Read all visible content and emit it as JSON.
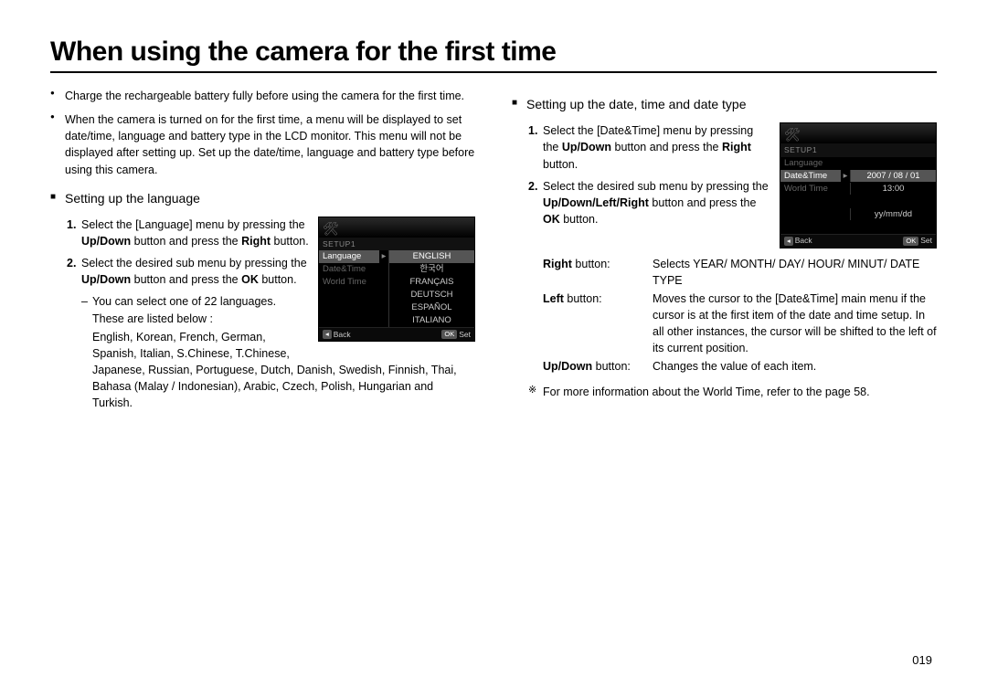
{
  "title": "When using the camera for the first time",
  "intro": {
    "p1": "Charge the rechargeable battery fully before using the camera for the first time.",
    "p2": "When the camera is turned on for the first time, a menu will be displayed to set date/time, language and battery type in the LCD monitor. This menu will not be displayed after setting up. Set up the date/time, language and battery type before using this camera."
  },
  "lang": {
    "heading": "Setting up the language",
    "step1_a": "Select the [Language] menu by pressing the ",
    "step1_b": "Up/Down",
    "step1_c": " button and press the ",
    "step1_d": "Right",
    "step1_e": " button.",
    "step2_a": "Select the desired sub menu by pressing the ",
    "step2_b": "Up/Down",
    "step2_c": " button and press the ",
    "step2_d": "OK",
    "step2_e": " button.",
    "note1": "You can select one of 22 languages. These are listed below :",
    "note2": "English, Korean, French, German, Spanish, Italian, S.Chinese, T.Chinese, Japanese, Russian, Portuguese, Dutch, Danish, Swedish, Finnish, Thai, Bahasa (Malay / Indonesian), Arabic, Czech, Polish, Hungarian and Turkish."
  },
  "lcd_lang": {
    "setup": "SETUP1",
    "rows": [
      {
        "left": "Language",
        "right": "ENGLISH",
        "selLeft": true,
        "selRight": true
      },
      {
        "left": "Date&Time",
        "right": "한국어"
      },
      {
        "left": "World Time",
        "right": "FRANÇAIS"
      },
      {
        "left": "",
        "right": "DEUTSCH"
      },
      {
        "left": "",
        "right": "ESPAÑOL"
      },
      {
        "left": "",
        "right": "ITALIANO"
      }
    ],
    "back": "Back",
    "set": "Set",
    "ok": "OK"
  },
  "date": {
    "heading": "Setting up the date, time and date type",
    "step1_a": "Select the [Date&Time] menu by pressing the ",
    "step1_b": "Up/Down",
    "step1_c": " button and press the ",
    "step1_d": "Right",
    "step1_e": " button.",
    "step2_a": "Select the desired sub menu by pressing the ",
    "step2_b": "Up/Down/Left/Right",
    "step2_c": " button and press the ",
    "step2_d": "OK",
    "step2_e": " button.",
    "right_label": "Right",
    "right_suffix": " button:",
    "right_val": "Selects YEAR/ MONTH/ DAY/ HOUR/ MINUT/ DATE TYPE",
    "left_label": "Left",
    "left_suffix": " button:",
    "left_val": "Moves the cursor to the [Date&Time] main menu if the cursor is at the first item of the date and time setup. In all other instances, the cursor will be shifted to the left of its current position.",
    "updown_label": "Up/Down",
    "updown_suffix": " button:",
    "updown_val": "Changes the value of each item.",
    "footnote": "For more information about the World Time, refer to the page 58."
  },
  "lcd_date": {
    "setup": "SETUP1",
    "r1_left": "Language",
    "r2_left": "Date&Time",
    "r2_right": "2007 / 08 / 01",
    "r3_left": "World Time",
    "r3_right": "13:00",
    "r4_right": "yy/mm/dd",
    "back": "Back",
    "set": "Set",
    "ok": "OK"
  },
  "page_number": "019"
}
